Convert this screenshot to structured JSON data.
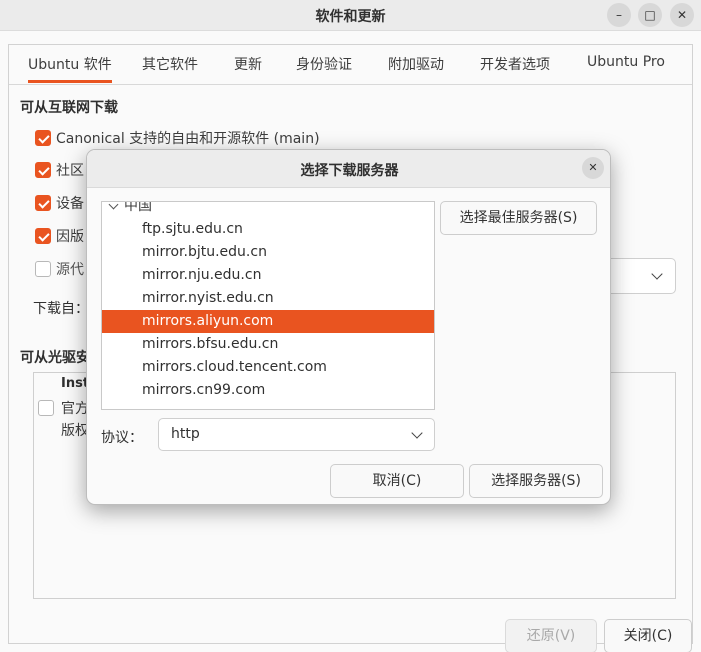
{
  "window": {
    "title": "软件和更新",
    "buttons": {
      "minimize": "–",
      "maximize": "□",
      "close": "✕"
    }
  },
  "tabs": [
    "Ubuntu 软件",
    "其它软件",
    "更新",
    "身份验证",
    "附加驱动",
    "开发者选项",
    "Ubuntu Pro"
  ],
  "active_tab": "Ubuntu 软件",
  "internet_section": {
    "title": "可从互联网下载",
    "checkboxes": [
      {
        "label": "Canonical 支持的自由和开源软件 (main)",
        "checked": true
      },
      {
        "label": "社区",
        "checked": true
      },
      {
        "label": "设备",
        "checked": true
      },
      {
        "label": "因版",
        "checked": true
      },
      {
        "label": "源代",
        "checked": false
      }
    ],
    "download_from_label": "下载自："
  },
  "cdrom_section": {
    "title": "可从光驱安",
    "item_title": "Inst",
    "item_line1": "官方",
    "item_line2": "版权",
    "item_checked": false
  },
  "footer": {
    "revert_label": "还原(V)",
    "close_label": "关闭(C)"
  },
  "dialog": {
    "title": "选择下载服务器",
    "close_glyph": "✕",
    "tree": {
      "country": "中国",
      "mirrors": [
        "ftp.sjtu.edu.cn",
        "mirror.bjtu.edu.cn",
        "mirror.nju.edu.cn",
        "mirror.nyist.edu.cn",
        "mirrors.aliyun.com",
        "mirrors.bfsu.edu.cn",
        "mirrors.cloud.tencent.com",
        "mirrors.cn99.com"
      ],
      "selected": "mirrors.aliyun.com"
    },
    "best_server_label": "选择最佳服务器(S)",
    "protocol_label": "协议：",
    "protocol_value": "http",
    "cancel_label": "取消(C)",
    "choose_label": "选择服务器(S)"
  },
  "colors": {
    "accent": "#e95420",
    "dialog_bg": "#fafafa",
    "titlebar_bg": "#ebebeb"
  },
  "icons": [
    "window-minimize-icon",
    "window-maximize-icon",
    "window-close-icon",
    "chevron-down-icon",
    "tree-expander-icon",
    "checkbox-check-icon"
  ]
}
